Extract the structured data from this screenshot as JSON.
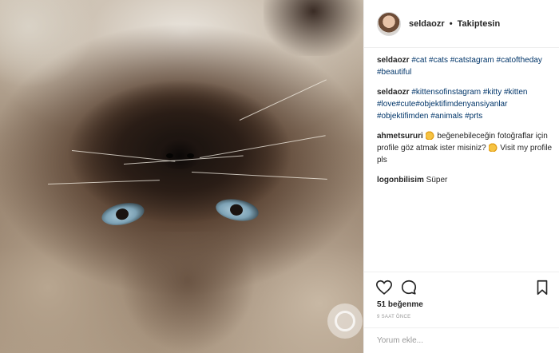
{
  "post": {
    "author": {
      "username": "seldaozr",
      "separator": "•",
      "follow_status": "Takiptesin"
    },
    "comments": [
      {
        "username": "seldaozr",
        "tags": [
          "#cat",
          "#cats",
          "#catstagram",
          "#catoftheday",
          "#beautiful"
        ]
      },
      {
        "username": "seldaozr",
        "tags": [
          "#kittensofinstagram",
          "#kitty",
          "#kitten",
          "#love",
          "#cute",
          "#objektifimdenyansiyanlar",
          "#objektifimden",
          "#animals",
          "#prts"
        ]
      },
      {
        "username": "ahmetsururi",
        "text_1": "beğenebileceğin fotoğraflar için profile göz atmak ister misiniz?",
        "text_2": "Visit my profile pls",
        "emoji": "pointing-hand-emoji"
      },
      {
        "username": "logonbilisim",
        "text": "Süper"
      }
    ],
    "likes_label": "51 beğenme",
    "timestamp": "9 SAAT ÖNCE",
    "add_comment_placeholder": "Yorum ekle..."
  },
  "icons": {
    "like": "heart-icon",
    "comment": "comment-bubble-icon",
    "save": "bookmark-icon"
  },
  "colors": {
    "hashtag": "#003569",
    "text": "#262626",
    "muted": "#999999",
    "divider": "#efefef"
  }
}
